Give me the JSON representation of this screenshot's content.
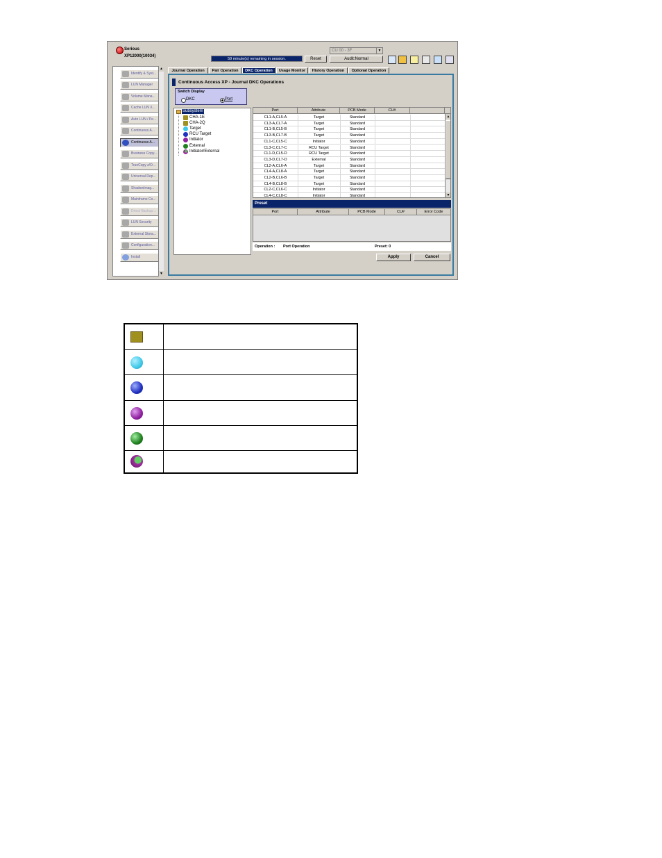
{
  "header": {
    "status": "Serious",
    "system_name": "XP12000(10034)",
    "session_text": "59 minute(s) remaining in session.",
    "reset_label": "Reset",
    "cu_select_value": "CU 00 - 3F",
    "audit_label": "Audit:Normal"
  },
  "sidebar": {
    "items": [
      {
        "label": "Identify & Syst..."
      },
      {
        "label": "LUN Manager"
      },
      {
        "label": "Volume Mana..."
      },
      {
        "label": "Cache LUN X..."
      },
      {
        "label": "Auto LUN / Pe..."
      },
      {
        "label": "Continuous A..."
      },
      {
        "label": "Continuous A..."
      },
      {
        "label": "Business Copy..."
      },
      {
        "label": "TrueCopy z/O..."
      },
      {
        "label": "Universal Rep..."
      },
      {
        "label": "ShadowImag..."
      },
      {
        "label": "Mainframe Co..."
      },
      {
        "label": "Direct Backup..."
      },
      {
        "label": "LUN Security"
      },
      {
        "label": "External Stora..."
      },
      {
        "label": "Configuration..."
      },
      {
        "label": "Install"
      }
    ]
  },
  "tabs": [
    {
      "label": "Journal Operation"
    },
    {
      "label": "Pair Operation"
    },
    {
      "label": "DKC Operation"
    },
    {
      "label": "Usage Monitor"
    },
    {
      "label": "History Operation"
    },
    {
      "label": "Optional Operation"
    }
  ],
  "page_title": "Continuous Access XP - Journal DKC Operations",
  "switch_display": {
    "title": "Switch Display",
    "dkc_label": "DKC",
    "port_label": "Port"
  },
  "tree": {
    "root": "Subsystem",
    "nodes": [
      {
        "label": "CHA-1E",
        "color": "#a09020"
      },
      {
        "label": "CHA-2Q",
        "color": "#a09020"
      },
      {
        "label": "Target",
        "color": "#40c8e8"
      },
      {
        "label": "RCU Target",
        "color": "#2030c0"
      },
      {
        "label": "Initiator",
        "color": "#9020a0"
      },
      {
        "label": "External",
        "color": "#208020"
      },
      {
        "label": "Initiator/External",
        "color": "#a030a0"
      }
    ]
  },
  "port_table": {
    "headers": [
      "Port",
      "Attribute",
      "PCB Mode",
      "CU#"
    ],
    "rows": [
      {
        "port": "CL1-A,CL5-A",
        "attribute": "Target",
        "pcb": "Standard"
      },
      {
        "port": "CL3-A,CL7-A",
        "attribute": "Target",
        "pcb": "Standard"
      },
      {
        "port": "CL1-B,CL5-B",
        "attribute": "Target",
        "pcb": "Standard"
      },
      {
        "port": "CL3-B,CL7-B",
        "attribute": "Target",
        "pcb": "Standard"
      },
      {
        "port": "CL1-C,CL5-C",
        "attribute": "Initiator",
        "pcb": "Standard"
      },
      {
        "port": "CL3-C,CL7-C",
        "attribute": "RCU Target",
        "pcb": "Standard"
      },
      {
        "port": "CL1-D,CL5-D",
        "attribute": "RCU Target",
        "pcb": "Standard"
      },
      {
        "port": "CL3-D,CL7-D",
        "attribute": "External",
        "pcb": "Standard"
      },
      {
        "port": "CL2-A,CL6-A",
        "attribute": "Target",
        "pcb": "Standard"
      },
      {
        "port": "CL4-A,CL8-A",
        "attribute": "Target",
        "pcb": "Standard"
      },
      {
        "port": "CL2-B,CL6-B",
        "attribute": "Target",
        "pcb": "Standard"
      },
      {
        "port": "CL4-B,CL8-B",
        "attribute": "Target",
        "pcb": "Standard"
      },
      {
        "port": "CL2-C,CL6-C",
        "attribute": "Initiator",
        "pcb": "Standard"
      },
      {
        "port": "CL4-C,CL8-C",
        "attribute": "Initiator",
        "pcb": "Standard"
      }
    ]
  },
  "preset": {
    "title": "Preset",
    "headers": [
      "Port",
      "Attribute",
      "PCB Mode",
      "CU#",
      "Error Code"
    ]
  },
  "footer": {
    "operation_label": "Operation :",
    "operation_value": "Port Operation",
    "preset_count": "Preset: 0",
    "apply_label": "Apply",
    "cancel_label": "Cancel"
  },
  "legend_icons": [
    {
      "icon": "cha-icon",
      "color": "#a09020"
    },
    {
      "icon": "target-port-icon",
      "color": "#40c8e8"
    },
    {
      "icon": "rcu-target-port-icon",
      "color": "#2030c0"
    },
    {
      "icon": "initiator-port-icon",
      "color": "#9020a0"
    },
    {
      "icon": "external-port-icon",
      "color": "#208020"
    },
    {
      "icon": "initiator-external-port-icon",
      "color": "#a030a0"
    }
  ]
}
